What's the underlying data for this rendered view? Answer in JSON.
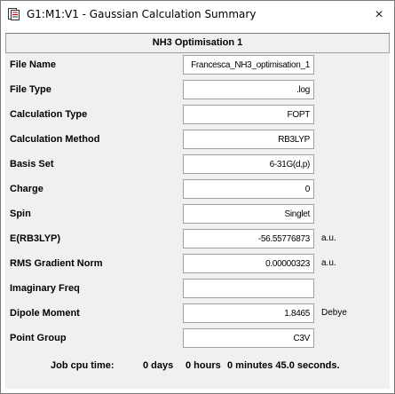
{
  "window": {
    "title": "G1:M1:V1 - Gaussian Calculation Summary",
    "close_icon": "×"
  },
  "summary": {
    "heading": "NH3 Optimisation 1",
    "rows": [
      {
        "label": "File Name",
        "value": "Francesca_NH3_optimisation_1",
        "unit": ""
      },
      {
        "label": "File Type",
        "value": ".log",
        "unit": ""
      },
      {
        "label": "Calculation Type",
        "value": "FOPT",
        "unit": ""
      },
      {
        "label": "Calculation Method",
        "value": "RB3LYP",
        "unit": ""
      },
      {
        "label": "Basis Set",
        "value": "6-31G(d,p)",
        "unit": ""
      },
      {
        "label": "Charge",
        "value": "0",
        "unit": ""
      },
      {
        "label": "Spin",
        "value": "Singlet",
        "unit": ""
      },
      {
        "label": "E(RB3LYP)",
        "value": "-56.55776873",
        "unit": "a.u."
      },
      {
        "label": "RMS Gradient Norm",
        "value": "0.00000323",
        "unit": "a.u."
      },
      {
        "label": "Imaginary Freq",
        "value": "",
        "unit": ""
      },
      {
        "label": "Dipole Moment",
        "value": "1.8465",
        "unit": "Debye"
      },
      {
        "label": "Point Group",
        "value": "C3V",
        "unit": ""
      }
    ]
  },
  "cpu_time": {
    "label": "Job cpu time:",
    "days": "0 days",
    "hours": "0 hours",
    "rest": "0 minutes 45.0 seconds."
  }
}
